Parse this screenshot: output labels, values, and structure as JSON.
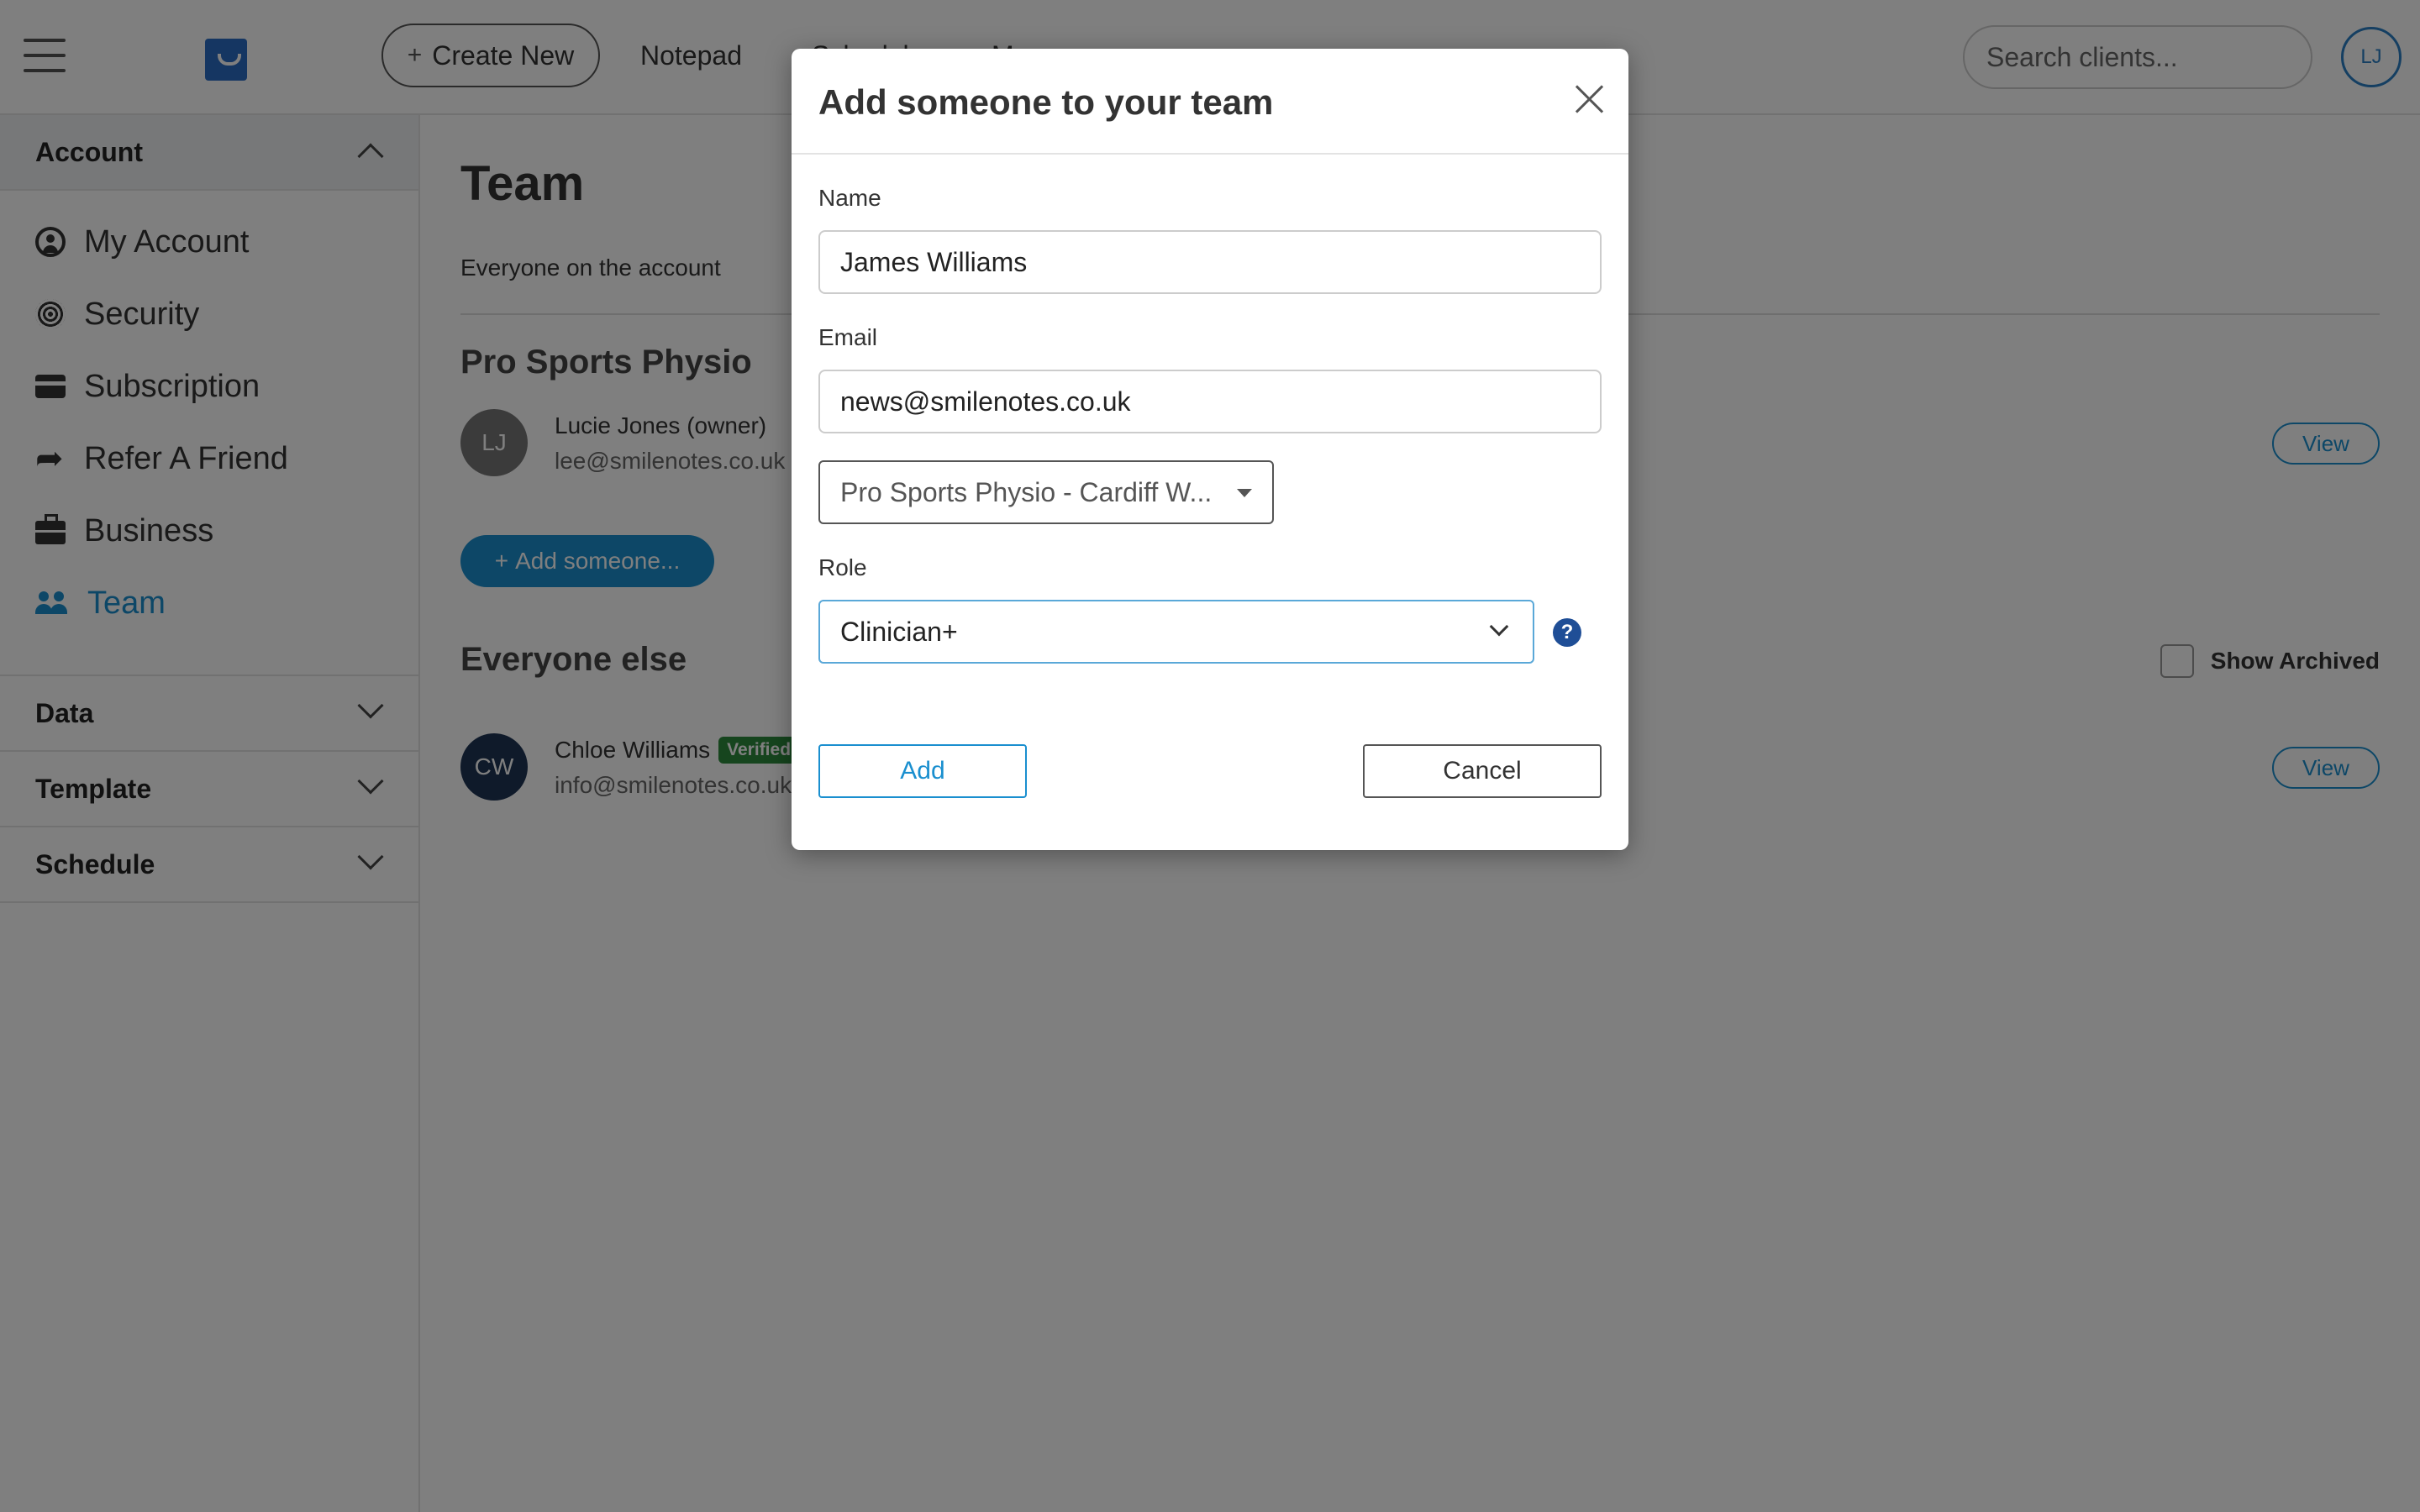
{
  "topbar": {
    "create_new_label": "Create New",
    "nav_items": [
      "Notepad",
      "Schedule",
      "M"
    ],
    "search_placeholder": "Search clients...",
    "user_initials": "LJ"
  },
  "sidebar": {
    "account": {
      "title": "Account",
      "items": [
        {
          "label": "My Account",
          "icon": "user-circle-icon"
        },
        {
          "label": "Security",
          "icon": "fingerprint-icon"
        },
        {
          "label": "Subscription",
          "icon": "credit-card-icon"
        },
        {
          "label": "Refer A Friend",
          "icon": "share-arrow-icon"
        },
        {
          "label": "Business",
          "icon": "briefcase-icon"
        },
        {
          "label": "Team",
          "icon": "team-icon",
          "active": true
        }
      ]
    },
    "data_title": "Data",
    "template_title": "Template",
    "schedule_title": "Schedule"
  },
  "main": {
    "title": "Team",
    "subtitle": "Everyone on the account",
    "group1_title": "Pro Sports Physio",
    "owner": {
      "initials": "LJ",
      "name": "Lucie Jones (owner)",
      "email": "lee@smilenotes.co.uk",
      "view_label": "View"
    },
    "add_someone_label": "Add someone...",
    "group2_title": "Everyone else",
    "show_archived_label": "Show Archived",
    "member": {
      "initials": "CW",
      "name": "Chloe Williams",
      "badge": "Verified",
      "email": "info@smilenotes.co.uk",
      "view_label": "View"
    }
  },
  "modal": {
    "title": "Add someone to your team",
    "name_label": "Name",
    "name_value": "James Williams",
    "email_label": "Email",
    "email_value": "news@smilenotes.co.uk",
    "business_value": "Pro Sports Physio - Cardiff W...",
    "role_label": "Role",
    "role_value": "Clinician+",
    "help_glyph": "?",
    "add_label": "Add",
    "cancel_label": "Cancel"
  },
  "colors": {
    "accent": "#1a8fcf",
    "verified": "#2c8a3c",
    "help": "#1f4e96",
    "overlay": "rgba(0,0,0,0.5)"
  }
}
